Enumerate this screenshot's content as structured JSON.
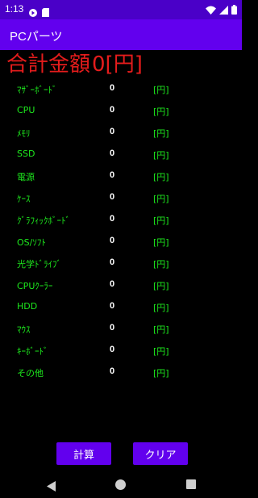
{
  "status_bar": {
    "time": "1:13",
    "icons": [
      "media-notification-icon",
      "sd-card-icon",
      "wifi-icon",
      "cell-signal-icon",
      "battery-icon"
    ]
  },
  "app_bar": {
    "title": "PCパーツ"
  },
  "total": {
    "label": "合計金額",
    "value": "0[円]"
  },
  "rows": [
    {
      "label": "ﾏｻﾞｰﾎﾞｰﾄﾞ",
      "value": "0",
      "unit": "[円]"
    },
    {
      "label": "CPU",
      "value": "0",
      "unit": "[円]"
    },
    {
      "label": "ﾒﾓﾘ",
      "value": "0",
      "unit": "[円]"
    },
    {
      "label": "SSD",
      "value": "0",
      "unit": "[円]"
    },
    {
      "label": "電源",
      "value": "0",
      "unit": "[円]"
    },
    {
      "label": "ｹｰｽ",
      "value": "0",
      "unit": "[円]"
    },
    {
      "label": "ｸﾞﾗﾌｨｯｸﾎﾞｰﾄﾞ",
      "value": "0",
      "unit": "[円]"
    },
    {
      "label": "OS/ｿﾌﾄ",
      "value": "0",
      "unit": "[円]"
    },
    {
      "label": "光学ﾄﾞﾗｲﾌﾞ",
      "value": "0",
      "unit": "[円]"
    },
    {
      "label": "CPUｸｰﾗｰ",
      "value": "0",
      "unit": "[円]"
    },
    {
      "label": "HDD",
      "value": "0",
      "unit": "[円]"
    },
    {
      "label": "ﾏｳｽ",
      "value": "0",
      "unit": "[円]"
    },
    {
      "label": "ｷｰﾎﾞｰﾄﾞ",
      "value": "0",
      "unit": "[円]"
    },
    {
      "label": "その他",
      "value": "0",
      "unit": "[円]"
    }
  ],
  "buttons": {
    "calc": "計算",
    "clear": "クリア"
  },
  "colors": {
    "status_bar": "#4a00c8",
    "app_bar": "#6200ee",
    "total_text": "#e51c1c",
    "label_text": "#1de91d",
    "value_text": "#ffffff",
    "background": "#000000"
  }
}
